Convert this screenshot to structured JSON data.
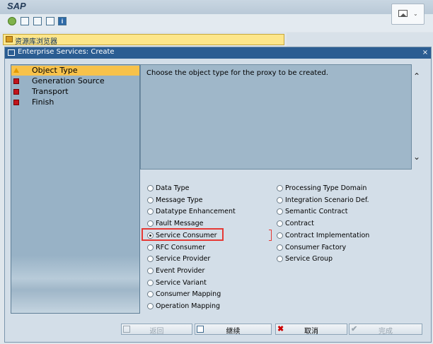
{
  "app": {
    "logo": "SAP"
  },
  "repository_bar": {
    "label": "资源库浏览器"
  },
  "dialog": {
    "title": "Enterprise Services: Create",
    "close": "×",
    "steps": [
      {
        "label": "Object Type",
        "status": "warning",
        "selected": true
      },
      {
        "label": "Generation Source",
        "status": "error",
        "selected": false
      },
      {
        "label": "Transport",
        "status": "error",
        "selected": false
      },
      {
        "label": "Finish",
        "status": "error",
        "selected": false
      }
    ],
    "instruction": "Choose the object type for the proxy to be created.",
    "scroll_up": "⌃",
    "scroll_down": "⌄",
    "options_left": [
      {
        "label": "Data Type",
        "selected": false
      },
      {
        "label": "Message Type",
        "selected": false
      },
      {
        "label": "Datatype Enhancement",
        "selected": false
      },
      {
        "label": "Fault Message",
        "selected": false
      },
      {
        "label": "Service Consumer",
        "selected": true
      },
      {
        "label": "RFC Consumer",
        "selected": false
      },
      {
        "label": "Service Provider",
        "selected": false
      },
      {
        "label": "Event Provider",
        "selected": false
      },
      {
        "label": "Service Variant",
        "selected": false
      },
      {
        "label": "Consumer Mapping",
        "selected": false
      },
      {
        "label": "Operation Mapping",
        "selected": false
      }
    ],
    "options_right": [
      {
        "label": "Processing Type Domain",
        "selected": false
      },
      {
        "label": "Integration Scenario Def.",
        "selected": false
      },
      {
        "label": "Semantic Contract",
        "selected": false
      },
      {
        "label": "Contract",
        "selected": false
      },
      {
        "label": "Contract Implementation",
        "selected": false
      },
      {
        "label": "Consumer Factory",
        "selected": false
      },
      {
        "label": "Service Group",
        "selected": false
      }
    ],
    "buttons": {
      "back": {
        "label": "返回",
        "enabled": false
      },
      "continue": {
        "label": "继续",
        "enabled": true
      },
      "cancel": {
        "label": "取消",
        "enabled": true
      },
      "complete": {
        "label": "完成",
        "enabled": false
      }
    }
  },
  "colors": {
    "title_bar": "#2b5d92",
    "selected_step": "#f7c24b",
    "highlight": "#e53935"
  }
}
